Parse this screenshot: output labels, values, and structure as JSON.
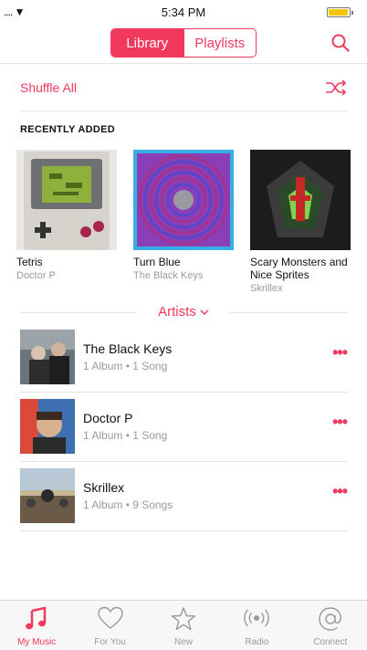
{
  "status_bar": {
    "signal": ".... ▼",
    "time": "5:34 PM",
    "battery_level": 0.95
  },
  "colors": {
    "accent": "#f0395c",
    "secondary_text": "#9a9a9a",
    "divider": "#e3e3e3",
    "battery": "#f4c400"
  },
  "nav": {
    "tabs": [
      {
        "label": "Library",
        "active": true
      },
      {
        "label": "Playlists",
        "active": false
      }
    ],
    "search_icon": "search-icon"
  },
  "shuffle": {
    "label": "Shuffle All",
    "icon": "shuffle-icon"
  },
  "recently_added": {
    "title": "RECENTLY ADDED",
    "albums": [
      {
        "title": "Tetris",
        "artist": "Doctor P",
        "art": "gameboy-cover"
      },
      {
        "title": "Turn Blue",
        "artist": "The Black Keys",
        "art": "spiral-cover"
      },
      {
        "title": "Scary Monsters and Nice Sprites",
        "artist": "Skrillex",
        "art": "monster-cover"
      }
    ]
  },
  "artists_section": {
    "label": "Artists",
    "icon": "chevron-down-icon",
    "items": [
      {
        "name": "The Black Keys",
        "meta": "1 Album • 1 Song",
        "more": "•••"
      },
      {
        "name": "Doctor P",
        "meta": "1 Album • 1 Song",
        "more": "•••"
      },
      {
        "name": "Skrillex",
        "meta": "1 Album • 9 Songs",
        "more": "•••"
      }
    ]
  },
  "tab_bar": {
    "items": [
      {
        "label": "My Music",
        "icon": "music-note-icon",
        "active": true
      },
      {
        "label": "For You",
        "icon": "heart-icon",
        "active": false
      },
      {
        "label": "New",
        "icon": "star-icon",
        "active": false
      },
      {
        "label": "Radio",
        "icon": "radio-icon",
        "active": false
      },
      {
        "label": "Connect",
        "icon": "at-icon",
        "active": false
      }
    ]
  }
}
